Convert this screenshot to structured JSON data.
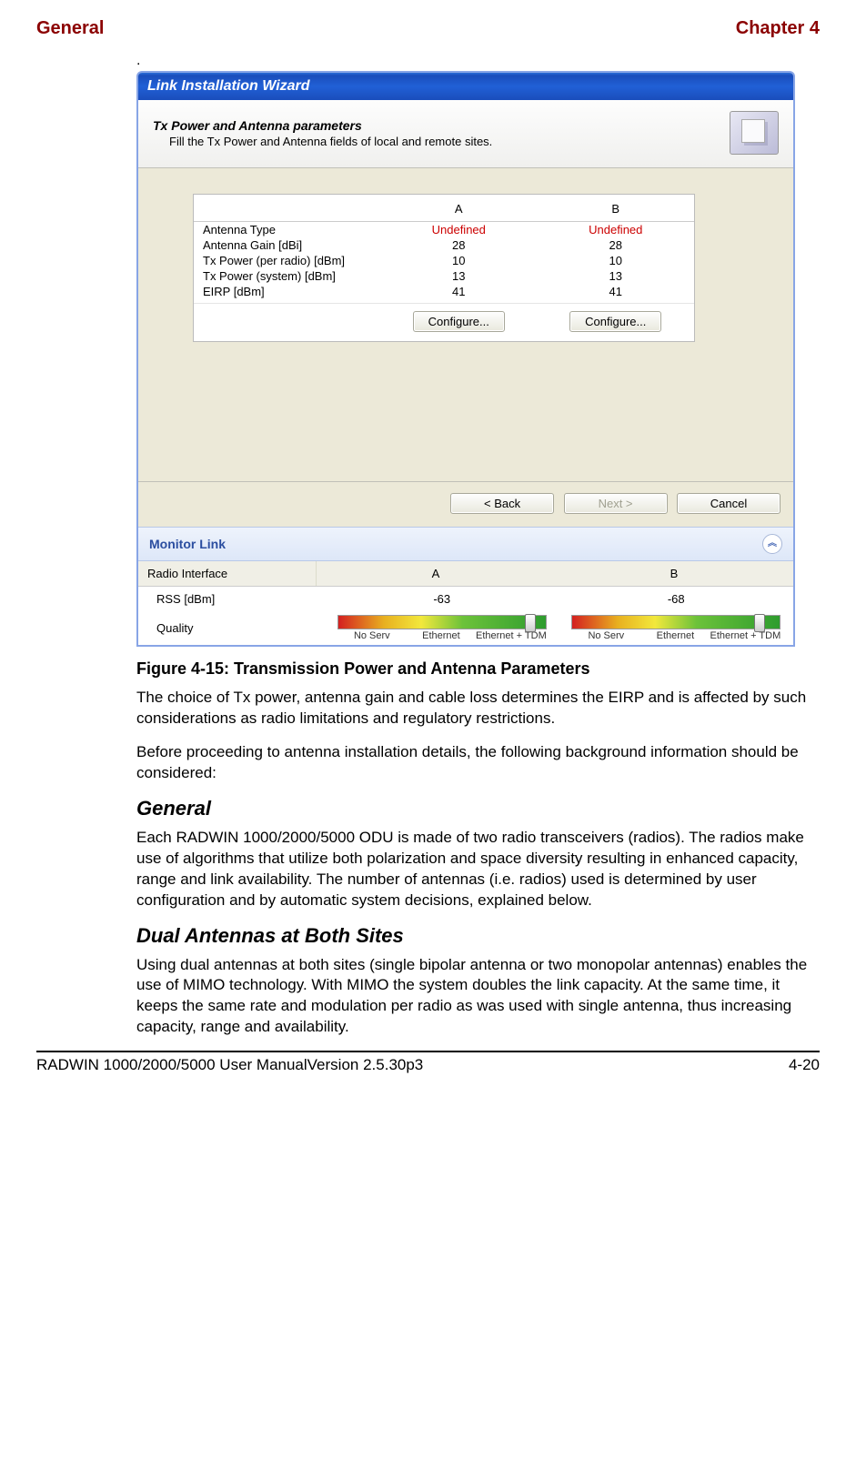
{
  "header": {
    "left": "General",
    "right": "Chapter 4"
  },
  "dot": ".",
  "window": {
    "title": "Link Installation Wizard",
    "wizardTitle": "Tx Power and Antenna parameters",
    "wizardSub": "Fill the Tx Power and Antenna fields of local and remote sites.",
    "cols": {
      "a": "A",
      "b": "B"
    },
    "rows": {
      "antennaType": {
        "label": "Antenna Type",
        "a": "Undefined",
        "b": "Undefined",
        "warn": true
      },
      "antennaGain": {
        "label": "Antenna Gain [dBi]",
        "a": "28",
        "b": "28"
      },
      "txPerRadio": {
        "label": "Tx Power (per radio) [dBm]",
        "a": "10",
        "b": "10"
      },
      "txSystem": {
        "label": "Tx Power (system) [dBm]",
        "a": "13",
        "b": "13"
      },
      "eirp": {
        "label": "EIRP [dBm]",
        "a": "41",
        "b": "41"
      }
    },
    "configureA": "Configure...",
    "configureB": "Configure...",
    "back": "< Back",
    "next": "Next >",
    "cancel": "Cancel",
    "monitor": {
      "title": "Monitor Link",
      "radioInterface": "Radio Interface",
      "colA": "A",
      "colB": "B",
      "rssLabel": "RSS [dBm]",
      "rssA": "-63",
      "rssB": "-68",
      "qualityLabel": "Quality",
      "qlabels": {
        "a": "No Serv",
        "b": "Ethernet",
        "c": "Ethernet + TDM"
      }
    }
  },
  "figureCaption": "Figure 4-15: Transmission Power and Antenna Parameters",
  "para1": "The choice of Tx power, antenna gain and cable loss determines the EIRP and is affected by such considerations as radio limitations and regulatory restrictions.",
  "para2": "Before proceeding to antenna installation details, the following background information should be considered:",
  "sectGeneral": "General",
  "paraGeneral": "Each RADWIN 1000/2000/5000 ODU is made of two radio transceivers (radios). The radios make use of algorithms that utilize both polarization and space diversity resulting in enhanced capacity, range and link availability. The number of antennas (i.e. radios) used is determined by user configuration and by automatic system decisions, explained below.",
  "sectDual": "Dual Antennas at Both Sites",
  "paraDual": "Using dual antennas at both sites (single bipolar antenna or two monopolar antennas) enables the use of MIMO technology. With MIMO the system doubles the link capacity. At the same time, it keeps the same rate and modulation per radio as was used with single antenna, thus increasing capacity, range and availability.",
  "footer": {
    "left": "RADWIN 1000/2000/5000 User ManualVersion  2.5.30p3",
    "right": "4-20"
  }
}
